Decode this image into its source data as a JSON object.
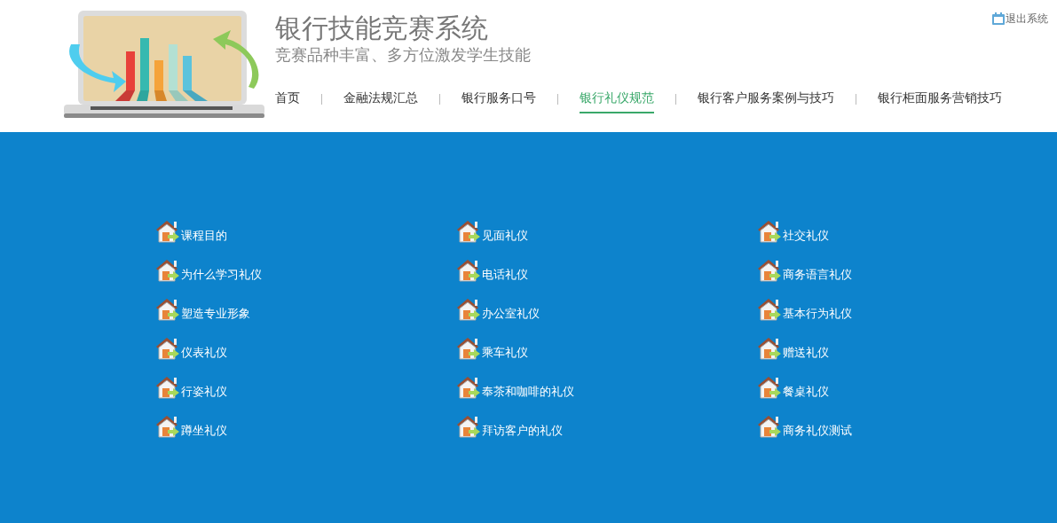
{
  "header": {
    "title": "银行技能竞赛系统",
    "subtitle": "竞赛品种丰富、多方位激发学生技能",
    "logout": "退出系统"
  },
  "nav": [
    {
      "label": "首页",
      "selected": false
    },
    {
      "label": "金融法规汇总",
      "selected": false
    },
    {
      "label": "银行服务口号",
      "selected": false
    },
    {
      "label": "银行礼仪规范",
      "selected": true
    },
    {
      "label": "银行客户服务案例与技巧",
      "selected": false
    },
    {
      "label": "银行柜面服务营销技巧",
      "selected": false
    }
  ],
  "columns": [
    [
      "课程目的",
      "为什么学习礼仪",
      "塑造专业形象",
      "仪表礼仪",
      "行姿礼仪",
      "蹲坐礼仪"
    ],
    [
      "见面礼仪",
      "电话礼仪",
      "办公室礼仪",
      "乘车礼仪",
      "奉茶和咖啡的礼仪",
      "拜访客户的礼仪"
    ],
    [
      "社交礼仪",
      "商务语言礼仪",
      "基本行为礼仪",
      "赠送礼仪",
      "餐桌礼仪",
      "商务礼仪测试"
    ]
  ]
}
